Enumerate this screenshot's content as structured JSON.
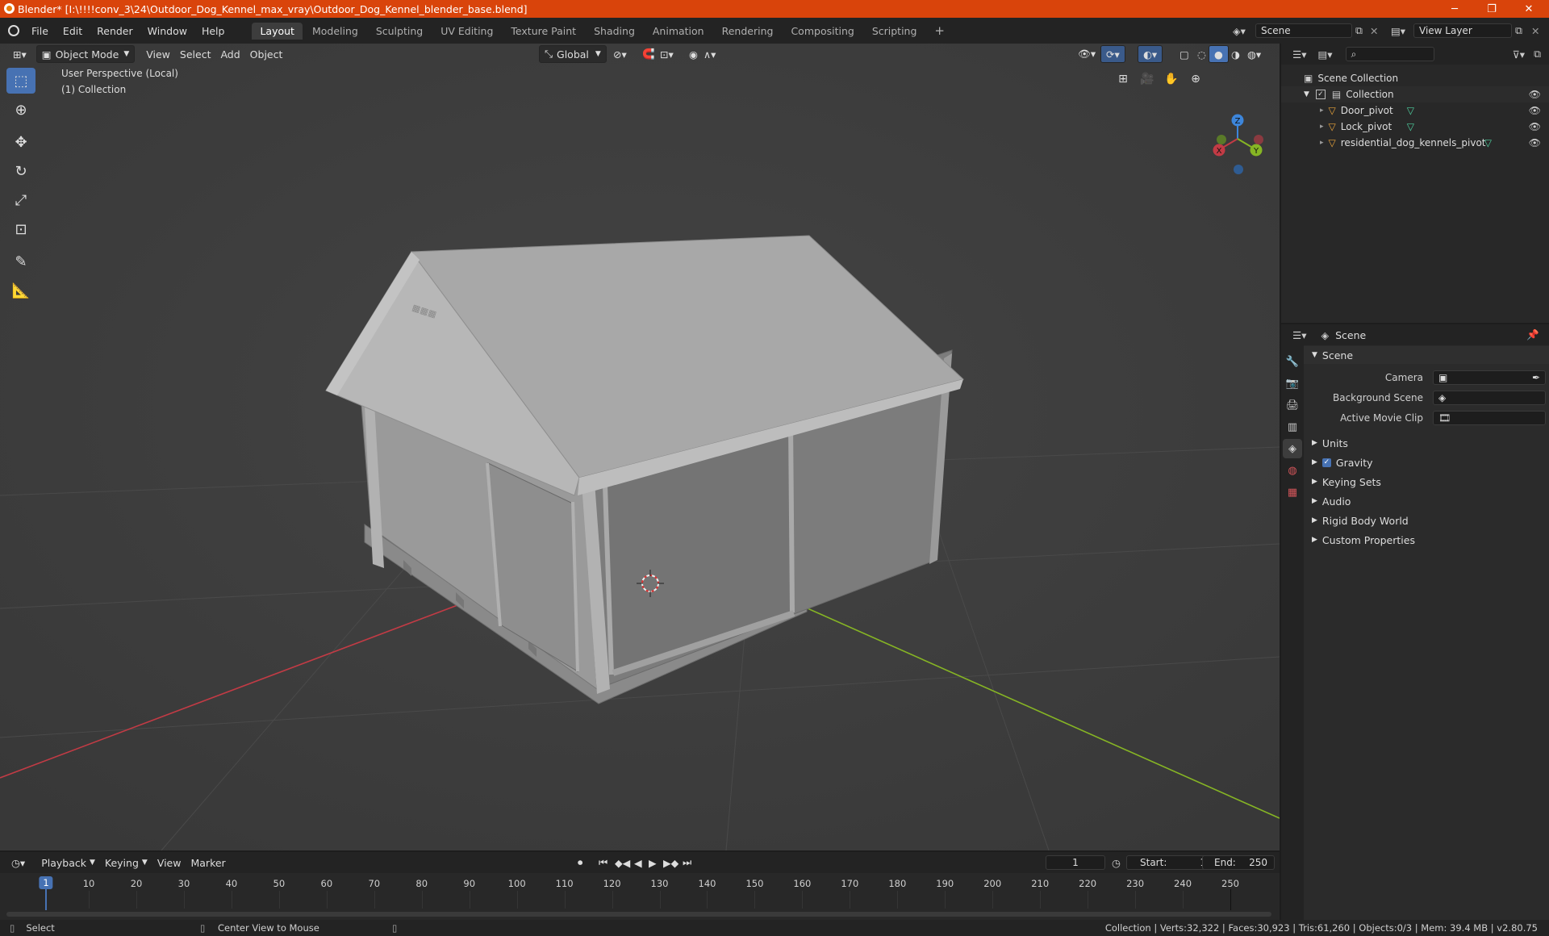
{
  "window": {
    "title": "Blender* [I:\\!!!!conv_3\\24\\Outdoor_Dog_Kennel_max_vray\\Outdoor_Dog_Kennel_blender_base.blend]",
    "minimize": "─",
    "maximize": "❐",
    "close": "✕"
  },
  "menu": {
    "file": "File",
    "edit": "Edit",
    "render": "Render",
    "window": "Window",
    "help": "Help"
  },
  "workspaces": [
    "Layout",
    "Modeling",
    "Sculpting",
    "UV Editing",
    "Texture Paint",
    "Shading",
    "Animation",
    "Rendering",
    "Compositing",
    "Scripting"
  ],
  "scene_selector": "Scene",
  "view_layer_selector": "View Layer",
  "viewport": {
    "mode": "Object Mode",
    "menus": {
      "view": "View",
      "select": "Select",
      "add": "Add",
      "object": "Object"
    },
    "transform_orientation": "Global",
    "overlay_title": "User Perspective (Local)",
    "overlay_collection": "(1) Collection",
    "gizmo": {
      "x": "X",
      "y": "Y",
      "z": "Z"
    }
  },
  "outliner": {
    "root": "Scene Collection",
    "collection": "Collection",
    "objects": [
      "Door_pivot",
      "Lock_pivot",
      "residential_dog_kennels_pivot"
    ]
  },
  "properties": {
    "header": "Scene",
    "panel": "Scene",
    "camera_label": "Camera",
    "background_label": "Background Scene",
    "movieclip_label": "Active Movie Clip",
    "sections": {
      "units": "Units",
      "gravity": "Gravity",
      "keying": "Keying Sets",
      "audio": "Audio",
      "rigid": "Rigid Body World",
      "custom": "Custom Properties"
    },
    "gravity_checked": true
  },
  "timeline": {
    "menus": {
      "playback": "Playback",
      "keying": "Keying",
      "view": "View",
      "marker": "Marker"
    },
    "current_frame": "1",
    "start_label": "Start:",
    "start": "1",
    "end_label": "End:",
    "end": "250",
    "ticks": [
      "1",
      "10",
      "20",
      "30",
      "40",
      "50",
      "60",
      "70",
      "80",
      "90",
      "100",
      "110",
      "120",
      "130",
      "140",
      "150",
      "160",
      "170",
      "180",
      "190",
      "200",
      "210",
      "220",
      "230",
      "240",
      "250"
    ],
    "frame_range": [
      1,
      250
    ]
  },
  "status": {
    "select": "Select",
    "center": "Center View to Mouse",
    "stats": "Collection | Verts:32,322 | Faces:30,923 | Tris:61,260 | Objects:0/3 | Mem: 39.4 MB | v2.80.75"
  },
  "colors": {
    "title_bar": "#d9440b",
    "active_tab": "#3d3d3d",
    "viewport_bg": "#3d3d3d",
    "accent": "#4772b3",
    "x_axis": "#c23b45",
    "y_axis": "#86b524",
    "z_axis": "#3d86db"
  }
}
